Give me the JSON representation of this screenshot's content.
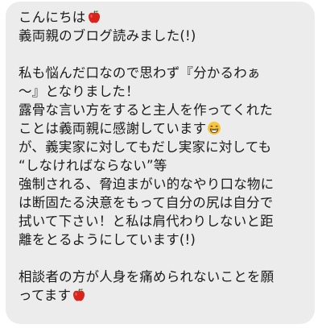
{
  "message": {
    "lines": [
      "こんにちは",
      "義両親のブログ読みました(!)",
      "",
      "私も悩んだ口なので思わず『分かるわぁ",
      "〜』となりました！",
      "露骨な言い方をすると主人を作ってくれた",
      "ことは義両親に感謝しています",
      "が、義実家に対してもだし実家に対しても",
      "“しなければならない”等",
      "強制される、脅迫まがい的なやり口な物に",
      "は断固たる決意をもって自分の尻は自分で",
      "拭いて下さい！と私は肩代わりしないと距",
      "離をとるようにしています(!)",
      "",
      "相談者の方が人身を痛められないことを願",
      "ってます"
    ],
    "icons": {
      "line_1": "apple-icon",
      "line_7": "grinning-face-icon",
      "line_16": "apple-icon"
    }
  },
  "colors": {
    "bubble_bg": "#ececec",
    "text": "#1a1a1a",
    "apple_red": "#d8241c",
    "emoji_yellow": "#f7c53a"
  }
}
